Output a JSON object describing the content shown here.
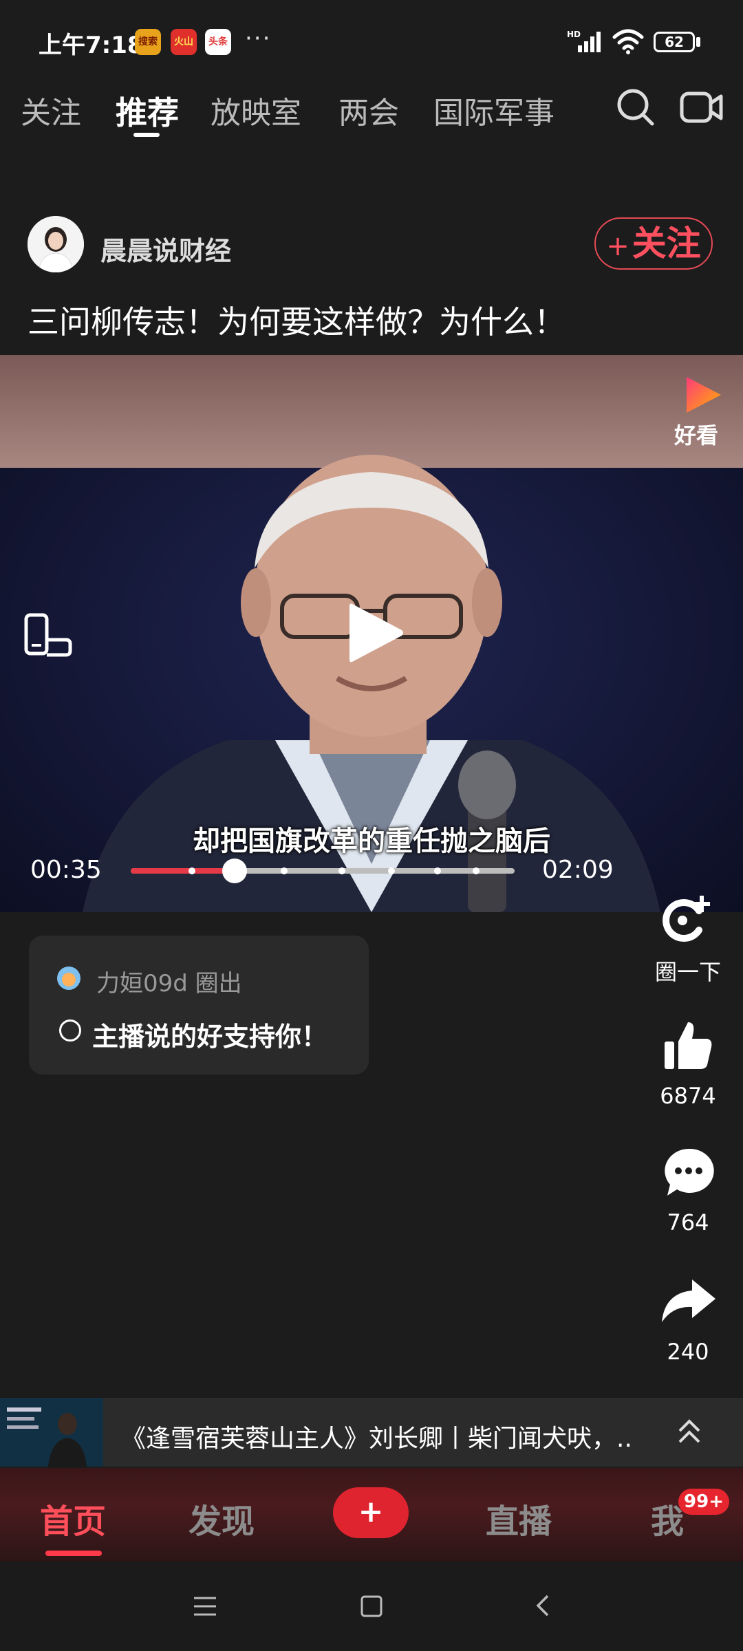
{
  "status_bar": {
    "time": "上午7:18",
    "app_icons": [
      {
        "label": "搜索",
        "color": "#e8a21b",
        "icon": "app-icon-1"
      },
      {
        "label": "火山",
        "color": "#e0302c",
        "icon": "app-icon-2"
      },
      {
        "label": "头条",
        "color": "#e23a3a",
        "icon": "app-icon-3"
      }
    ],
    "more": "···",
    "network": "HD",
    "battery": "62"
  },
  "tabs": [
    {
      "label": "关注",
      "active": false
    },
    {
      "label": "推荐",
      "active": true
    },
    {
      "label": "放映室",
      "active": false
    },
    {
      "label": "两会",
      "active": false
    },
    {
      "label": "国际军事",
      "active": false
    }
  ],
  "post": {
    "author": "晨晨说财经",
    "follow_plus": "+",
    "follow_label": "关注",
    "title": "三问柳传志！为何要这样做？为什么！"
  },
  "video": {
    "watermark": "好看",
    "subtitle": "却把国旗改革的重任抛之脑后",
    "current_time": "00:35",
    "total_time": "02:09",
    "progress": 0.271,
    "chapter_marks": [
      0.16,
      0.4,
      0.55,
      0.68,
      0.8,
      0.9
    ]
  },
  "comment": {
    "user": "力姮09d 圈出",
    "text": "主播说的好支持你！"
  },
  "actions": {
    "circle_label": "圈一下",
    "likes": "6874",
    "comments": "764",
    "shares": "240"
  },
  "banner": {
    "text": "《逢雪宿芙蓉山主人》刘长卿丨柴门闻犬吠，..."
  },
  "nav": {
    "home": "首页",
    "discover": "发现",
    "add": "+",
    "live": "直播",
    "me": "我",
    "badge": "99+"
  },
  "colors": {
    "accent": "#ff4f5b",
    "background": "#1c1c1c",
    "progress": "#e53a47"
  }
}
